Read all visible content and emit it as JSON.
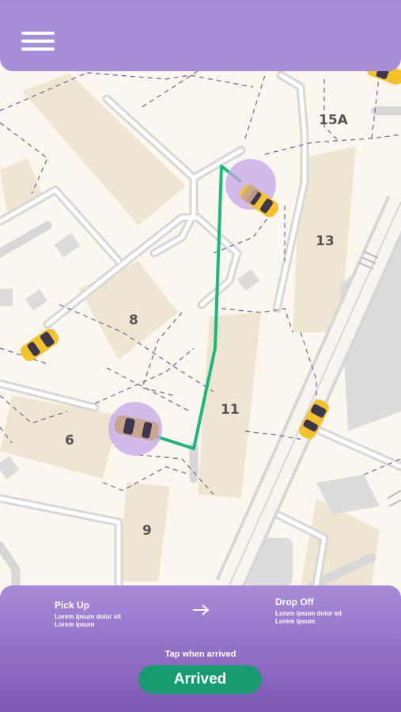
{
  "header": {
    "menu_icon": "hamburger-menu-icon"
  },
  "map": {
    "block_labels": [
      "15A",
      "13",
      "8",
      "11",
      "6",
      "9"
    ],
    "route_color": "#1ab77f",
    "marker_color": "#c4a7ea"
  },
  "trip": {
    "pickup": {
      "title": "Pick Up",
      "line1": "Lorem ipsum dolor sit",
      "line2": "Lorem ipsum"
    },
    "dropoff": {
      "title": "Drop Off",
      "line1": "Lorem ipsum dolor sit",
      "line2": "Lorem ipsum"
    },
    "arrow_icon": "arrow-right-icon",
    "tap_hint": "Tap when arrived",
    "arrived_label": "Arrived",
    "accent_color": "#189a71"
  }
}
